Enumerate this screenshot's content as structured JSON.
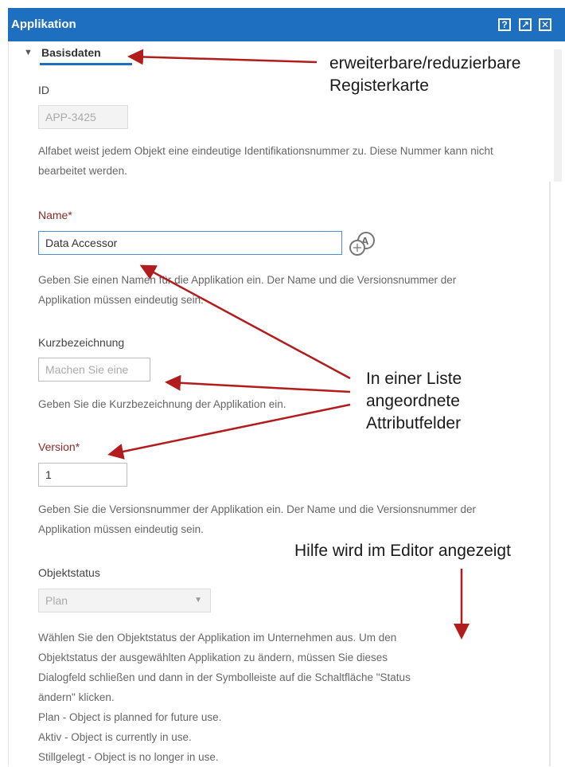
{
  "window": {
    "title": "Applikation",
    "buttons": [
      {
        "name": "help-icon",
        "glyph": "?"
      },
      {
        "name": "popout-icon",
        "glyph": "↗"
      },
      {
        "name": "close-icon",
        "glyph": "✕"
      }
    ]
  },
  "section": {
    "label": "Basisdaten",
    "expanded": true
  },
  "fields": {
    "id": {
      "label": "ID",
      "value": "APP-3425",
      "help": "Alfabet weist jedem Objekt eine eindeutige Identifikationsnummer zu. Diese Nummer kann nicht bearbeitet werden."
    },
    "name": {
      "label": "Name*",
      "value": "Data Accessor",
      "help": "Geben Sie einen Namen für die Applikation ein. Der Name und die Versionsnummer der Applikation müssen eindeutig sein."
    },
    "short_name": {
      "label": "Kurzbezeichnung",
      "placeholder": "Machen Sie eine",
      "help": "Geben Sie die Kurzbezeichnung der Applikation ein."
    },
    "version": {
      "label": "Version*",
      "value": "1",
      "help": "Geben Sie die Versionsnummer der Applikation ein. Der Name und die Versionsnummer der Applikation müssen eindeutig sein."
    },
    "status": {
      "label": "Objektstatus",
      "selected": "Plan",
      "help_lines": [
        "Wählen Sie den Objektstatus der Applikation im Unternehmen aus. Um den",
        "Objektstatus der ausgewählten Applikation zu ändern, müssen Sie dieses",
        "Dialogfeld schließen und dann in der Symbolleiste auf die Schaltfläche \"Status",
        "ändern\" klicken.",
        "Plan - Object is planned for future use.",
        "Aktiv - Object is currently in use.",
        "Stillgelegt - Object is no longer in use."
      ]
    }
  },
  "annotations": {
    "tab_note": [
      "erweiterbare/reduzierbare",
      "Registerkarte"
    ],
    "list_note": [
      "In einer Liste",
      "angeordnete",
      "Attributfelder"
    ],
    "help_note": "Hilfe wird im Editor angezeigt"
  },
  "colors": {
    "titlebar": "#1e6fbf",
    "annotation_arrow": "#b21c1c",
    "required_label": "#8b2a2a"
  }
}
